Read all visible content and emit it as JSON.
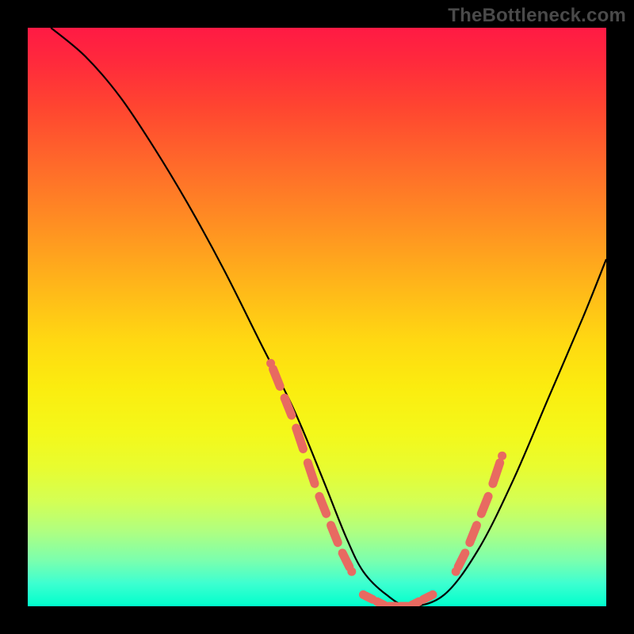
{
  "watermark": "TheBottleneck.com",
  "chart_data": {
    "type": "line",
    "title": "",
    "xlabel": "",
    "ylabel": "",
    "xlim": [
      0,
      100
    ],
    "ylim": [
      0,
      100
    ],
    "grid": false,
    "legend": false,
    "series": [
      {
        "name": "bottleneck-curve",
        "color": "#000000",
        "x": [
          4,
          10,
          16,
          22,
          28,
          34,
          40,
          46,
          51,
          55,
          58,
          62,
          66,
          72,
          78,
          84,
          90,
          96,
          100
        ],
        "y": [
          100,
          95,
          88,
          79,
          69,
          58,
          46,
          34,
          22,
          12,
          6,
          2,
          0,
          2,
          10,
          22,
          36,
          50,
          60
        ]
      },
      {
        "name": "highlight-left",
        "color": "#e86a61",
        "style": "thick-dashed",
        "x": [
          42,
          44,
          46,
          48,
          50,
          52,
          54,
          56
        ],
        "y": [
          42,
          37,
          32,
          26,
          20,
          15,
          10,
          6
        ]
      },
      {
        "name": "highlight-bottom",
        "color": "#e86a61",
        "style": "thick-dashed",
        "x": [
          58,
          60,
          62,
          64,
          66,
          68,
          70
        ],
        "y": [
          2,
          1,
          0,
          0,
          0,
          1,
          2
        ]
      },
      {
        "name": "highlight-right",
        "color": "#e86a61",
        "style": "thick-dashed",
        "x": [
          74,
          76,
          78,
          80,
          82
        ],
        "y": [
          6,
          10,
          15,
          20,
          26
        ]
      }
    ],
    "background_gradient": {
      "direction": "vertical",
      "stops": [
        {
          "pos": 0.0,
          "color": "#ff1a44"
        },
        {
          "pos": 0.5,
          "color": "#ffd400"
        },
        {
          "pos": 0.8,
          "color": "#e8ff40"
        },
        {
          "pos": 1.0,
          "color": "#00ffcc"
        }
      ]
    }
  }
}
